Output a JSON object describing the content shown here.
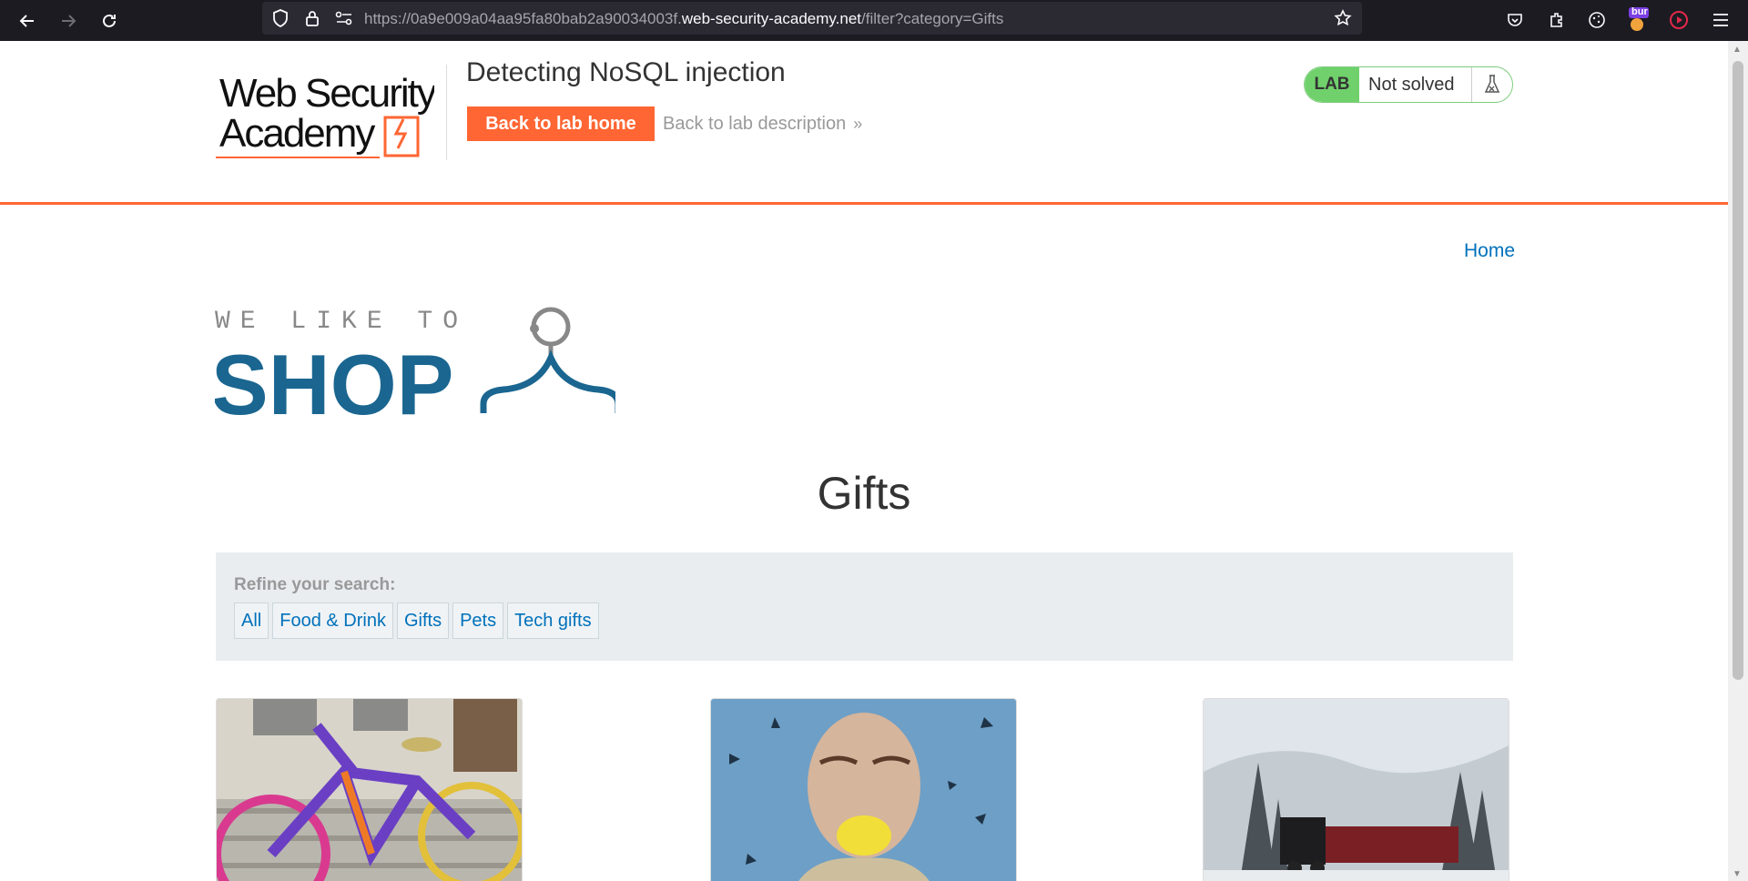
{
  "browser": {
    "url_prefix": "https://0a9e009a04aa95fa80bab2a90034003f.",
    "url_host": "web-security-academy.net",
    "url_path": "/filter?category=Gifts",
    "extension_badge": "bur",
    "colors": {
      "chrome_bg": "#1c1b22",
      "urlbar_bg": "#2b2a33"
    }
  },
  "lab": {
    "logo_line1": "Web Security",
    "logo_line2": "Academy",
    "title": "Detecting NoSQL injection",
    "back_home_label": "Back to lab home",
    "back_description_label": "Back to lab description",
    "status_tag": "LAB",
    "status_text": "Not solved",
    "colors": {
      "accent": "#ff6633",
      "solved_tag": "#70d16c"
    }
  },
  "shop": {
    "nav_home": "Home",
    "logo_tagline": "WE LIKE TO",
    "logo_word": "SHOP",
    "category_title": "Gifts",
    "filter_label": "Refine your search:",
    "filters": [
      "All",
      "Food & Drink",
      "Gifts",
      "Pets",
      "Tech gifts"
    ],
    "products": [
      {
        "image": "knitted-bicycle-photo"
      },
      {
        "image": "man-biting-lemon-photo"
      },
      {
        "image": "snowy-train-photo"
      }
    ],
    "colors": {
      "brand": "#1a6690",
      "link": "#0071bc",
      "filter_bg": "#e9edf0"
    }
  }
}
